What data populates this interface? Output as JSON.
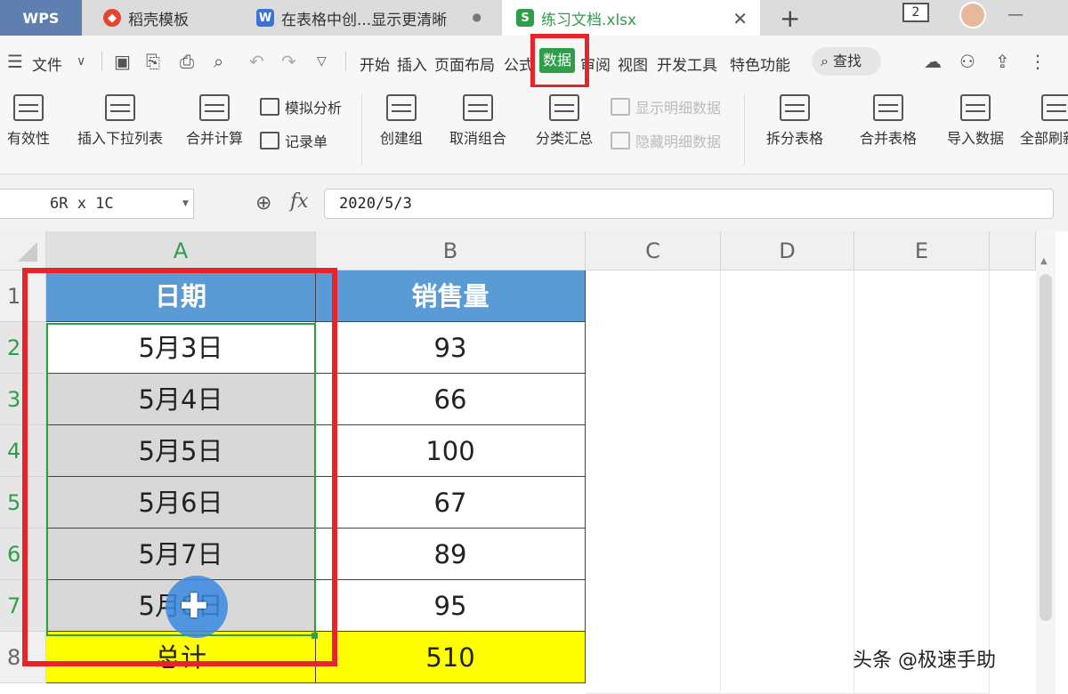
{
  "tabs": {
    "wps": "WPS",
    "daoke": "稻壳模板",
    "word_doc": "在表格中创...显示更清晰",
    "active_file": "练习文档.xlsx",
    "window_count": "2"
  },
  "menu": {
    "file": "文件",
    "items": [
      "开始",
      "插入",
      "页面布局",
      "公式",
      "数据",
      "审阅",
      "视图",
      "开发工具",
      "特色功能"
    ],
    "active": "数据",
    "search": "查找"
  },
  "ribbon": {
    "validity": "有效性",
    "insert_dropdown_list": "插入下拉列表",
    "merge_calc": "合并计算",
    "what_if": "模拟分析",
    "record_form": "记录单",
    "create_group": "创建组",
    "ungroup": "取消组合",
    "subtotal": "分类汇总",
    "show_detail": "显示明细数据",
    "hide_detail": "隐藏明细数据",
    "split_table": "拆分表格",
    "merge_table": "合并表格",
    "import_data": "导入数据",
    "refresh_all": "全部刷新"
  },
  "formula_bar": {
    "name_box": "6R x 1C",
    "fx": "fx",
    "value": "2020/5/3"
  },
  "sheet": {
    "columns": [
      "A",
      "B",
      "C",
      "D",
      "E"
    ],
    "rows": [
      "1",
      "2",
      "3",
      "4",
      "5",
      "6",
      "7",
      "8"
    ],
    "header": {
      "date": "日期",
      "sales": "销售量"
    },
    "data": [
      {
        "date": "5月3日",
        "sales": "93"
      },
      {
        "date": "5月4日",
        "sales": "66"
      },
      {
        "date": "5月5日",
        "sales": "100"
      },
      {
        "date": "5月6日",
        "sales": "67"
      },
      {
        "date": "5月7日",
        "sales": "89"
      },
      {
        "date": "5月8日",
        "sales": "95"
      }
    ],
    "total": {
      "label": "总计",
      "value": "510"
    }
  },
  "watermark": "头条 @极速手助",
  "colors": {
    "accent_green": "#2e9e49",
    "header_blue": "#5b9bd5",
    "total_yellow": "#ffff00",
    "annotation_red": "#e8242a"
  }
}
